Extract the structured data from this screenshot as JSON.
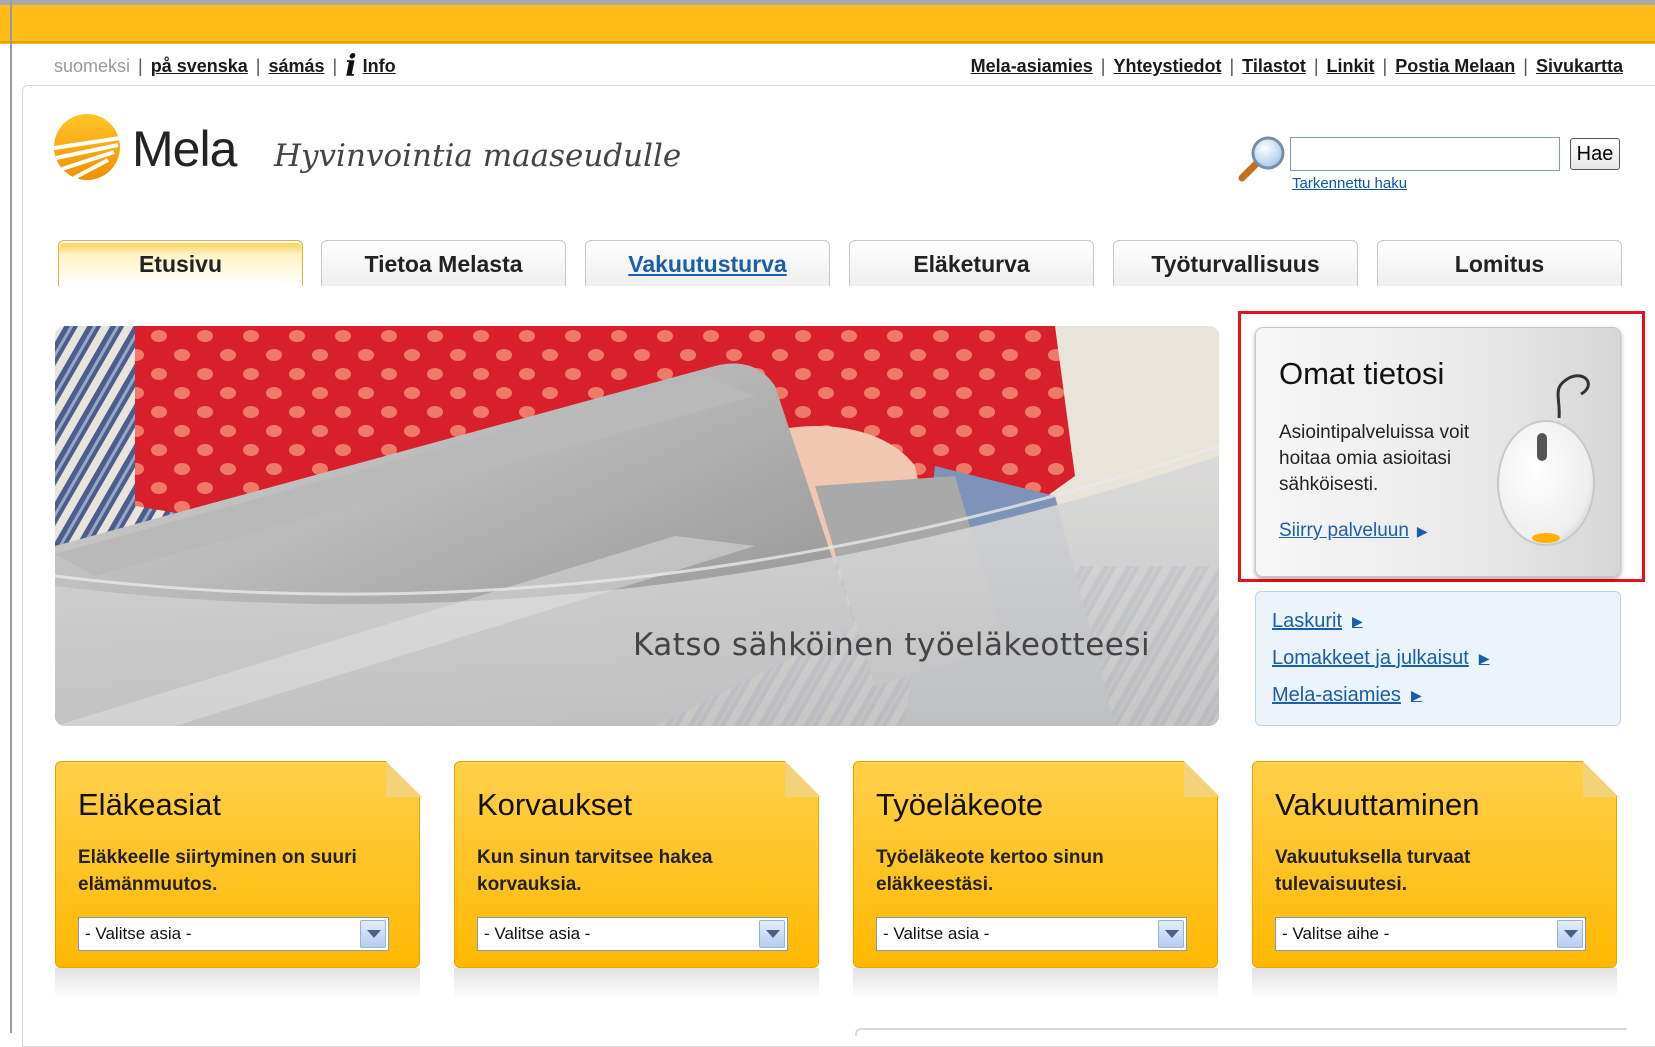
{
  "util_nav": {
    "lang_current": "suomeksi",
    "lang_svenska": "på svenska",
    "lang_samas": "sámás",
    "info": "Info",
    "links": [
      "Mela-asiamies",
      "Yhteystiedot",
      "Tilastot",
      "Linkit",
      "Postia Melaan",
      "Sivukartta"
    ]
  },
  "header": {
    "logo_text": "Mela",
    "slogan": "Hyvinvointia maaseudulle",
    "search_button": "Hae",
    "advanced_search": "Tarkennettu haku",
    "search_value": ""
  },
  "tabs": [
    "Etusivu",
    "Tietoa Melasta",
    "Vakuutusturva",
    "Eläketurva",
    "Työturvallisuus",
    "Lomitus"
  ],
  "banner": {
    "caption": "Katso sähköinen työeläkeotteesi"
  },
  "omat": {
    "title": "Omat tietosi",
    "text": "Asiointipalveluissa voit hoitaa omia asioitasi sähköisesti.",
    "link": "Siirry palveluun"
  },
  "quick_links": [
    "Laskurit",
    "Lomakkeet ja julkaisut",
    "Mela-asiamies"
  ],
  "cards": [
    {
      "title": "Eläkeasiat",
      "text": "Eläkkeelle siirtyminen on suuri elämänmuutos.",
      "select": "- Valitse asia -"
    },
    {
      "title": "Korvaukset",
      "text": "Kun sinun tarvitsee hakea korvauksia.",
      "select": "- Valitse asia -"
    },
    {
      "title": "Työeläkeote",
      "text": "Työeläkeote kertoo sinun eläkkeestäsi.",
      "select": "- Valitse asia -"
    },
    {
      "title": "Vakuuttaminen",
      "text": "Vakuutuksella turvaat tulevaisuutesi.",
      "select": "- Valitse aihe -"
    }
  ],
  "colors": {
    "brand_yellow": "#ffbd19",
    "link_blue": "#1a5fa8",
    "highlight_red": "#e8101a"
  }
}
